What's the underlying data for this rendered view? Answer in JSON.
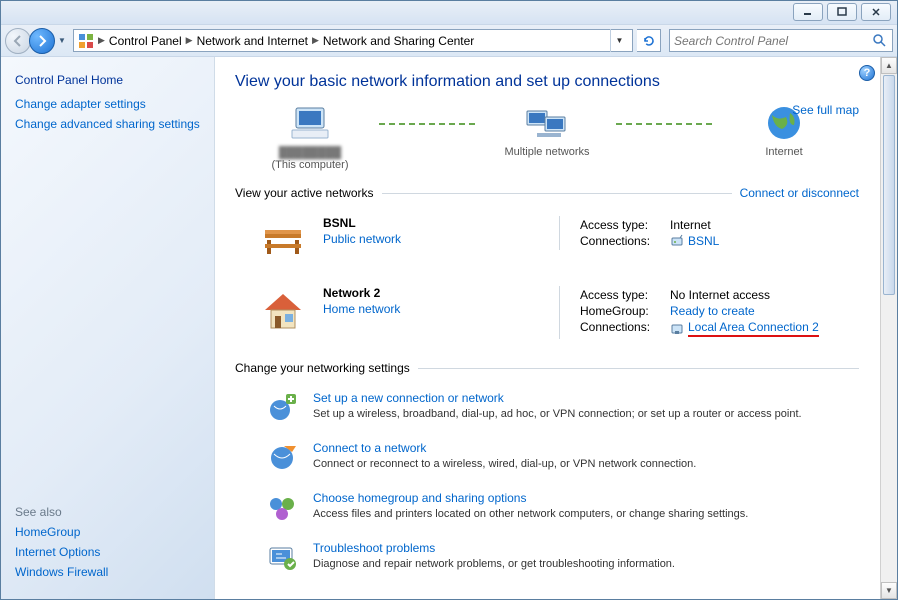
{
  "breadcrumb": {
    "root_icon": "category-icon",
    "items": [
      "Control Panel",
      "Network and Internet",
      "Network and Sharing Center"
    ]
  },
  "search": {
    "placeholder": "Search Control Panel"
  },
  "sidebar": {
    "home_label": "Control Panel Home",
    "links": [
      {
        "label": "Change adapter settings"
      },
      {
        "label": "Change advanced sharing settings"
      }
    ],
    "see_also_header": "See also",
    "see_also": [
      {
        "label": "HomeGroup"
      },
      {
        "label": "Internet Options"
      },
      {
        "label": "Windows Firewall"
      }
    ]
  },
  "page": {
    "title": "View your basic network information and set up connections",
    "see_full_map": "See full map",
    "map": {
      "node1_sub": "(This computer)",
      "node2": "Multiple networks",
      "node3": "Internet"
    },
    "active_header": "View your active networks",
    "connect_or_disconnect": "Connect or disconnect",
    "networks": [
      {
        "name": "BSNL",
        "type_label": "Public network",
        "access_label": "Access type:",
        "access_value": "Internet",
        "conn_label": "Connections:",
        "conn_value": "BSNL"
      },
      {
        "name": "Network  2",
        "type_label": "Home network",
        "access_label": "Access type:",
        "access_value": "No Internet access",
        "hg_label": "HomeGroup:",
        "hg_value": "Ready to create",
        "conn_label": "Connections:",
        "conn_value": "Local Area Connection 2"
      }
    ],
    "change_header": "Change your networking settings",
    "settings": [
      {
        "title": "Set up a new connection or network",
        "desc": "Set up a wireless, broadband, dial-up, ad hoc, or VPN connection; or set up a router or access point."
      },
      {
        "title": "Connect to a network",
        "desc": "Connect or reconnect to a wireless, wired, dial-up, or VPN network connection."
      },
      {
        "title": "Choose homegroup and sharing options",
        "desc": "Access files and printers located on other network computers, or change sharing settings."
      },
      {
        "title": "Troubleshoot problems",
        "desc": "Diagnose and repair network problems, or get troubleshooting information."
      }
    ]
  }
}
